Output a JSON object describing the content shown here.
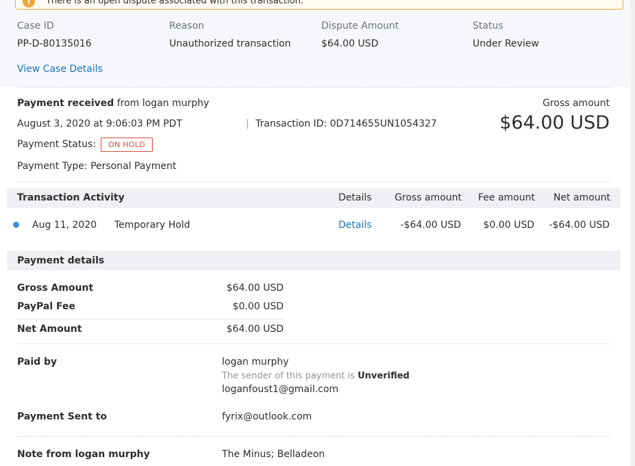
{
  "alert": {
    "text": "There is an open dispute associated with this transaction."
  },
  "case": {
    "labels": {
      "case_id": "Case ID",
      "reason": "Reason",
      "amount": "Dispute Amount",
      "status": "Status"
    },
    "values": {
      "case_id": "PP-D-80135016",
      "reason": "Unauthorized transaction",
      "amount": "$64.00 USD",
      "status": "Under Review"
    },
    "link": "View Case Details"
  },
  "payment": {
    "received_label": "Payment received",
    "received_from": " from logan murphy",
    "date": "August 3, 2020 at 9:06:03 PM PDT",
    "txn_sep": "|",
    "transaction_id": "Transaction ID: 0D714655UN1054327",
    "status_label": "Payment Status:",
    "status_badge": "ON HOLD",
    "type": "Payment Type: Personal Payment",
    "gross_label": "Gross amount",
    "gross_amount": "$64.00 USD"
  },
  "activity": {
    "title": "Transaction Activity",
    "columns": {
      "details": "Details",
      "gross": "Gross amount",
      "fee": "Fee amount",
      "net": "Net amount"
    },
    "rows": [
      {
        "date": "Aug 11, 2020",
        "description": "Temporary Hold",
        "details": "Details",
        "gross": "-$64.00 USD",
        "fee": "$0.00 USD",
        "net": "-$64.00 USD"
      }
    ]
  },
  "payment_details": {
    "title": "Payment details",
    "gross_label": "Gross Amount",
    "gross_value": "$64.00 USD",
    "fee_label": "PayPal Fee",
    "fee_value": "$0.00 USD",
    "net_label": "Net Amount",
    "net_value": "$64.00 USD",
    "paid_by_label": "Paid by",
    "paid_by_name": "logan murphy",
    "sender_note": "The sender of this payment is ",
    "sender_status": "Unverified",
    "paid_by_email": "loganfoust1@gmail.com",
    "sent_to_label": "Payment Sent to",
    "sent_to_email": "fyrix@outlook.com",
    "note_label": "Note from logan murphy",
    "note_value": "The Minus; Belladeon"
  },
  "colors": {
    "link": "#1c72b8",
    "alert_border": "#f0a73b",
    "on_hold": "#d64b3b",
    "dot": "#3a8fcf"
  }
}
